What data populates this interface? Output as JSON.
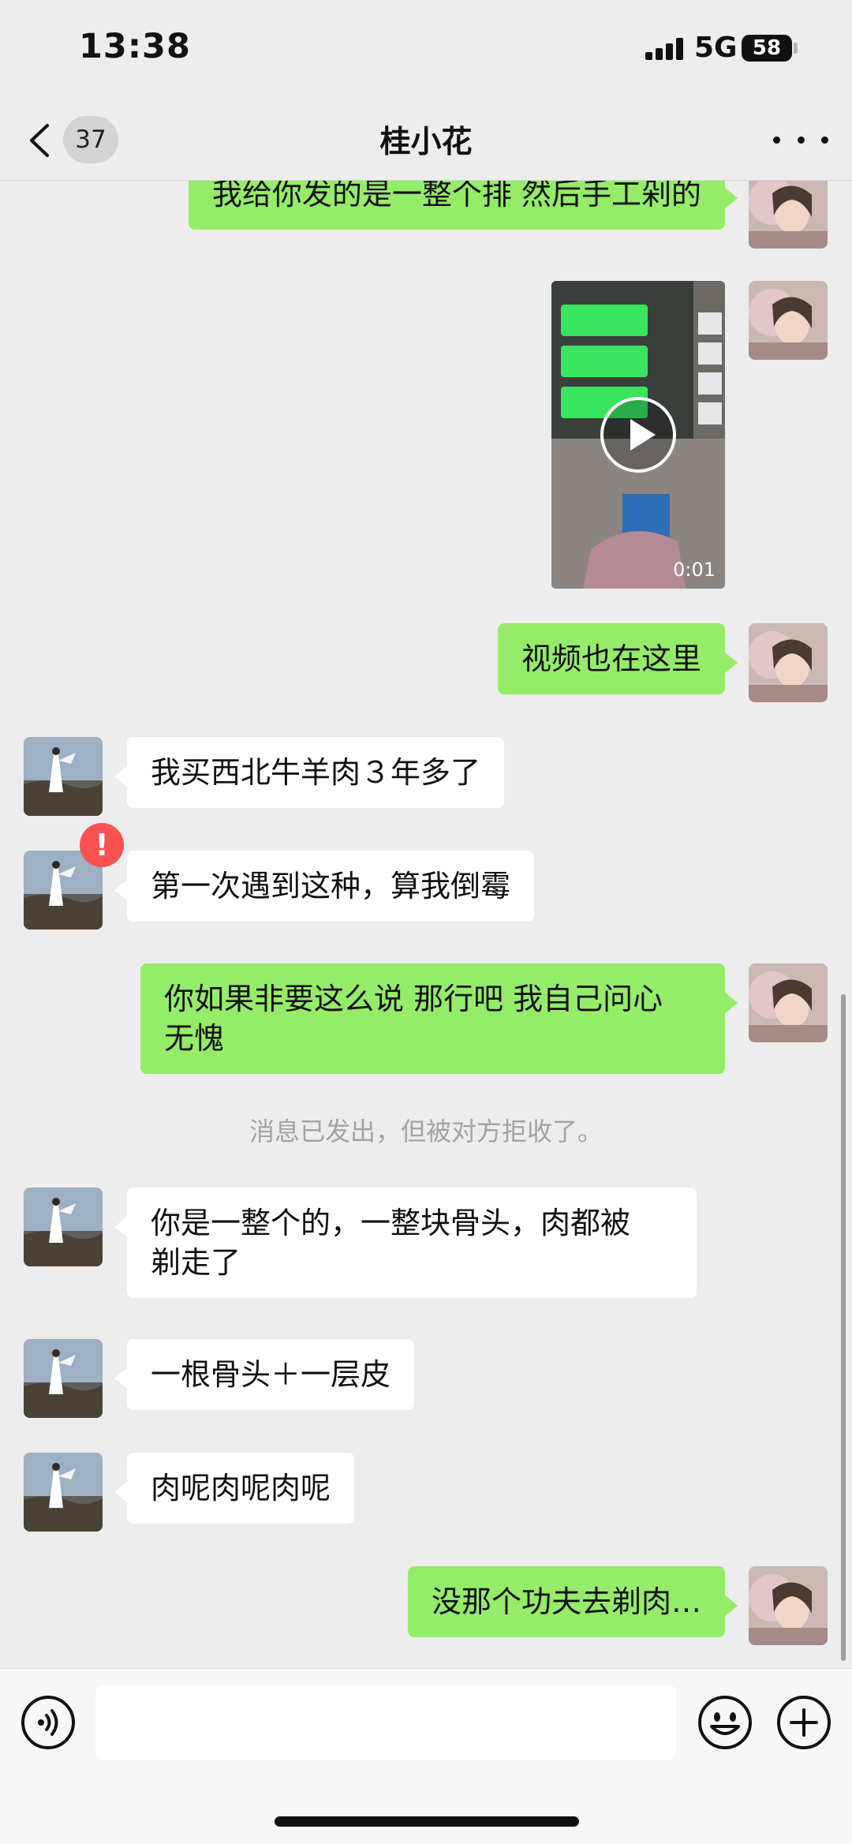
{
  "status_bar": {
    "time": "13:38",
    "network": "5G",
    "battery": "58"
  },
  "header": {
    "back_badge": "37",
    "title": "桂小花",
    "more_icon": "more-dots-icon"
  },
  "colors": {
    "outgoing_bubble": "#95ec69",
    "incoming_bubble": "#ffffff",
    "background": "#ededed",
    "error": "#fa5151"
  },
  "messages": [
    {
      "from": "me",
      "type": "text",
      "text": "我给你发的是一整个排 然后手工剁的"
    },
    {
      "from": "me",
      "type": "video",
      "duration": "0:01"
    },
    {
      "from": "me",
      "type": "text",
      "text": "视频也在这里"
    },
    {
      "from": "them",
      "type": "text",
      "text": "我买西北牛羊肉３年多了"
    },
    {
      "from": "them",
      "type": "text",
      "text": "第一次遇到这种，算我倒霉"
    },
    {
      "from": "me",
      "type": "text",
      "text": "你如果非要这么说 那行吧 我自己问心\n无愧",
      "status_icon": "!"
    },
    {
      "from": "system",
      "type": "note",
      "text": "消息已发出，但被对方拒收了。"
    },
    {
      "from": "them",
      "type": "text",
      "text": "你是一整个的，一整块骨头，肉都被\n剃走了"
    },
    {
      "from": "them",
      "type": "text",
      "text": "一根骨头＋一层皮"
    },
    {
      "from": "them",
      "type": "text",
      "text": "肉呢肉呢肉呢"
    },
    {
      "from": "me",
      "type": "text",
      "text": "没那个功夫去剃肉…"
    }
  ],
  "input_bar": {
    "placeholder": "",
    "left_icon": "voice-icon",
    "emoji_icon": "emoji-icon",
    "plus_icon": "plus-icon"
  }
}
